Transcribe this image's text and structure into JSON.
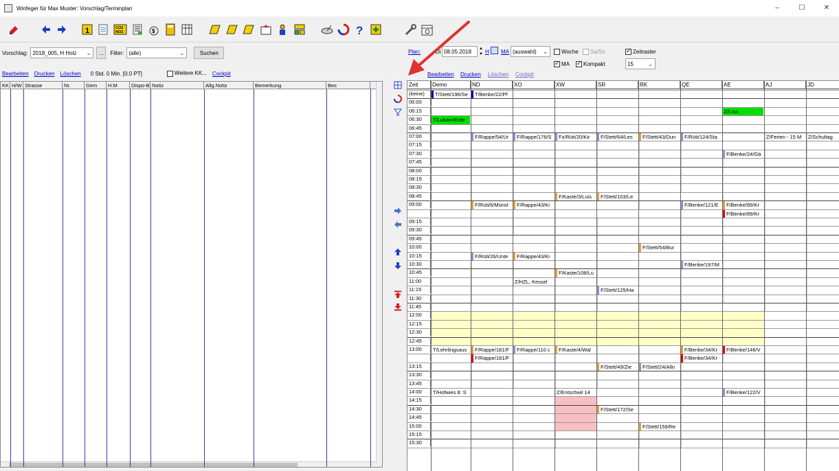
{
  "window": {
    "title": "Winfeger für Max Muster: Vorschlag/Terminplan",
    "minimize": "–",
    "maximize": "☐",
    "close": "✕"
  },
  "left": {
    "vorschlag_label": "Vorschlag:",
    "vorschlag_value": "2018_005, H Holz",
    "ellipsis": "...",
    "filter_label": "Filter:",
    "filter_value": "(alle)",
    "search_button": "Suchen",
    "bearbeiten": "Bearbeiten",
    "drucken": "Drucken",
    "loeschen": "Löschen",
    "std_info": "0 Std. 0 Min. [0.0 PT]",
    "weitere_kk": "Weitere KK...",
    "cockpit": "Cockpit",
    "columns": [
      "KK",
      "H/W",
      "Strasse",
      "Nr.",
      "Gem",
      "H:M",
      "Dispo-Bemerkung",
      "Notiz",
      "Allg.Notiz",
      "Bemerkung",
      "Bes"
    ]
  },
  "plan": {
    "plan_label": "Plan:",
    "weekday": "Di",
    "date": "08.05.2018",
    "h_link": "H",
    "ma_link": "MA",
    "ma_value": "(auswahl)",
    "woche": "Woche",
    "sa_so": "Sa/So",
    "zeitraster": "Zeitraster",
    "ma_check": "MA",
    "kompakt": "Kompakt",
    "raster_value": "15",
    "bearbeiten": "Bearbeiten",
    "drucken": "Drucken",
    "loeschen": "Löschen",
    "cockpit": "Cockpit"
  },
  "calendar": {
    "headers": [
      "Zeit",
      "Demo",
      "ND",
      "XO",
      "XW",
      "SR",
      "RK",
      "QE",
      "AE",
      "AJ",
      "JD"
    ],
    "times": [
      "(keine)",
      "06:00",
      "06:15",
      "06:30",
      "06:45",
      "07:00",
      "07:15",
      "07:30",
      "07:45",
      "08:00",
      "08:15",
      "08:30",
      "08:45",
      "09:00",
      "",
      "09:15",
      "09:30",
      "09:45",
      "10:00",
      "10:15",
      "10:30",
      "10:45",
      "11:00",
      "11:15",
      "11:30",
      "11:45",
      "12:00",
      "12:15",
      "12:30",
      "12:45",
      "13:00",
      "",
      "13:15",
      "13:30",
      "13:45",
      "14:00",
      "14:15",
      "14:30",
      "14:45",
      "15:00",
      "15:15",
      "15:30"
    ],
    "entries": [
      {
        "row": 0,
        "col": 1,
        "text": "T/Stett/196/Se",
        "bar": "#0000aa"
      },
      {
        "row": 0,
        "col": 2,
        "text": "T/Benke/22/Pf",
        "bar": "#0000aa"
      },
      {
        "row": 2,
        "col": 8,
        "text": "Z/Lisa",
        "bg": "#00e000"
      },
      {
        "row": 3,
        "col": 1,
        "text": "T/Lukas=Erde",
        "bg": "#00e000"
      },
      {
        "row": 5,
        "col": 2,
        "text": "F/Rappe/54/Ur",
        "bar": "#9090d0"
      },
      {
        "row": 5,
        "col": 3,
        "text": "F/Rappe/176/S",
        "bar": "#9090d0"
      },
      {
        "row": 5,
        "col": 4,
        "text": "Fx/Rüti/20/Kir",
        "bar": "#9090d0"
      },
      {
        "row": 5,
        "col": 5,
        "text": "F/Stett/64/Les",
        "bar": "#9090d0"
      },
      {
        "row": 5,
        "col": 6,
        "text": "F/Stett/43/Dun",
        "bar": "#e0a040"
      },
      {
        "row": 5,
        "col": 7,
        "text": "F/Rüti/124/Sta",
        "bar": "#9090d0"
      },
      {
        "row": 5,
        "col": 9,
        "text": "Z/Ferien - 15 M"
      },
      {
        "row": 5,
        "col": 10,
        "text": "Z/Schultag"
      },
      {
        "row": 7,
        "col": 8,
        "text": "F/Benke/24/Gä",
        "bar": "#9090d0"
      },
      {
        "row": 12,
        "col": 4,
        "text": "F/Kaste/3/Luis",
        "bar": "#e0a040"
      },
      {
        "row": 12,
        "col": 5,
        "text": "F/Stett/103/Le",
        "bar": "#e0a040"
      },
      {
        "row": 13,
        "col": 2,
        "text": "F/Rüti/6/Münst",
        "bar": "#e0a040"
      },
      {
        "row": 13,
        "col": 3,
        "text": "F/Rappe/43/Ki",
        "bar": "#e0a040"
      },
      {
        "row": 13,
        "col": 7,
        "text": "F/Benke/121/E",
        "bar": "#9090d0"
      },
      {
        "row": 13,
        "col": 8,
        "text": "F/Benke/89/Kr",
        "bar": "#e0a040"
      },
      {
        "row": 14,
        "col": 8,
        "text": "F/Benke/89/Kr",
        "bar": "#dd0000"
      },
      {
        "row": 18,
        "col": 6,
        "text": "F/Stett/54/Bur",
        "bar": "#e0a040"
      },
      {
        "row": 19,
        "col": 2,
        "text": "F/Rüti/26/Unte",
        "bar": "#9090d0"
      },
      {
        "row": 19,
        "col": 3,
        "text": "F/Rappe/43/Ki",
        "bar": "#e0a040"
      },
      {
        "row": 20,
        "col": 7,
        "text": "F/Benke/197/M",
        "bar": "#9090d0"
      },
      {
        "row": 21,
        "col": 4,
        "text": "F/Kaste/108/Lu",
        "bar": "#e0a040"
      },
      {
        "row": 22,
        "col": 3,
        "text": "Z/HZL, Kessel"
      },
      {
        "row": 23,
        "col": 5,
        "text": "F/Stett/125/Ha",
        "bar": "#9090d0"
      },
      {
        "row": 30,
        "col": 1,
        "text": "T/Lehrlingsaus"
      },
      {
        "row": 30,
        "col": 2,
        "text": "F/Rappe/181/F",
        "bar": "#e0a040"
      },
      {
        "row": 30,
        "col": 3,
        "text": "F/Rappe/110 c",
        "bar": "#9090d0"
      },
      {
        "row": 30,
        "col": 4,
        "text": "F/Kaste/4/Wal",
        "bar": "#e0a040"
      },
      {
        "row": 30,
        "col": 7,
        "text": "F/Benke/34/Kr",
        "bar": "#e0a040"
      },
      {
        "row": 30,
        "col": 8,
        "text": "F/Benke/146/V",
        "bar": "#dd0000"
      },
      {
        "row": 31,
        "col": 2,
        "text": "F/Rappe/181/F",
        "bar": "#dd0000"
      },
      {
        "row": 31,
        "col": 7,
        "text": "F/Benke/34/Kr",
        "bar": "#dd0000"
      },
      {
        "row": 32,
        "col": 5,
        "text": "F/Stett/49/Zie",
        "bar": "#e0a040"
      },
      {
        "row": 32,
        "col": 6,
        "text": "F/Stett/24/Alln",
        "bar": "#9090d0"
      },
      {
        "row": 35,
        "col": 1,
        "text": "T/Hofwies 8: S"
      },
      {
        "row": 35,
        "col": 4,
        "text": "Z/Entschwil 14"
      },
      {
        "row": 35,
        "col": 8,
        "text": "F/Benke/122/V",
        "bar": "#9090d0"
      },
      {
        "row": 37,
        "col": 5,
        "text": "F/Stett/172/Se",
        "bar": "#e0a040"
      },
      {
        "row": 39,
        "col": 6,
        "text": "F/Stett/159/Re",
        "bar": "#e0a040"
      }
    ]
  },
  "colors": {
    "busy": "#c8c8c8",
    "lunch": "#ffffc8",
    "pink": "#f8c0c0",
    "link": "#0000cc",
    "arrow": "#e03030"
  }
}
